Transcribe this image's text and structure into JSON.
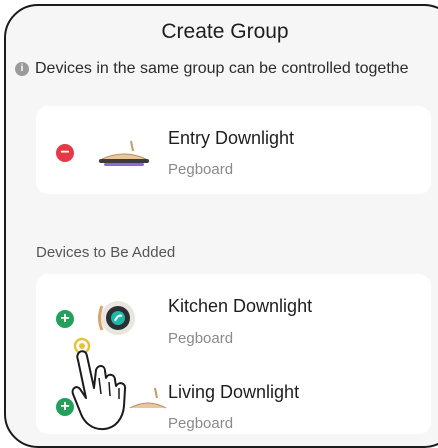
{
  "title": "Create Group",
  "hint": "Devices in the same group can be controlled togethe",
  "group": {
    "devices": [
      {
        "name": "Entry Downlight",
        "room": "Pegboard"
      }
    ]
  },
  "to_add": {
    "label": "Devices to Be Added",
    "devices": [
      {
        "name": "Kitchen Downlight",
        "room": "Pegboard"
      },
      {
        "name": "Living Downlight",
        "room": "Pegboard"
      }
    ]
  },
  "icons": {
    "remove": "minus-circle-icon",
    "add": "plus-circle-icon",
    "info": "info-icon",
    "downlight": "downlight-icon",
    "ring": "ring-light-icon",
    "hand": "tap-hand-icon"
  },
  "colors": {
    "remove": "#e53945",
    "add": "#23a05b",
    "background": "#f6f6f6"
  }
}
